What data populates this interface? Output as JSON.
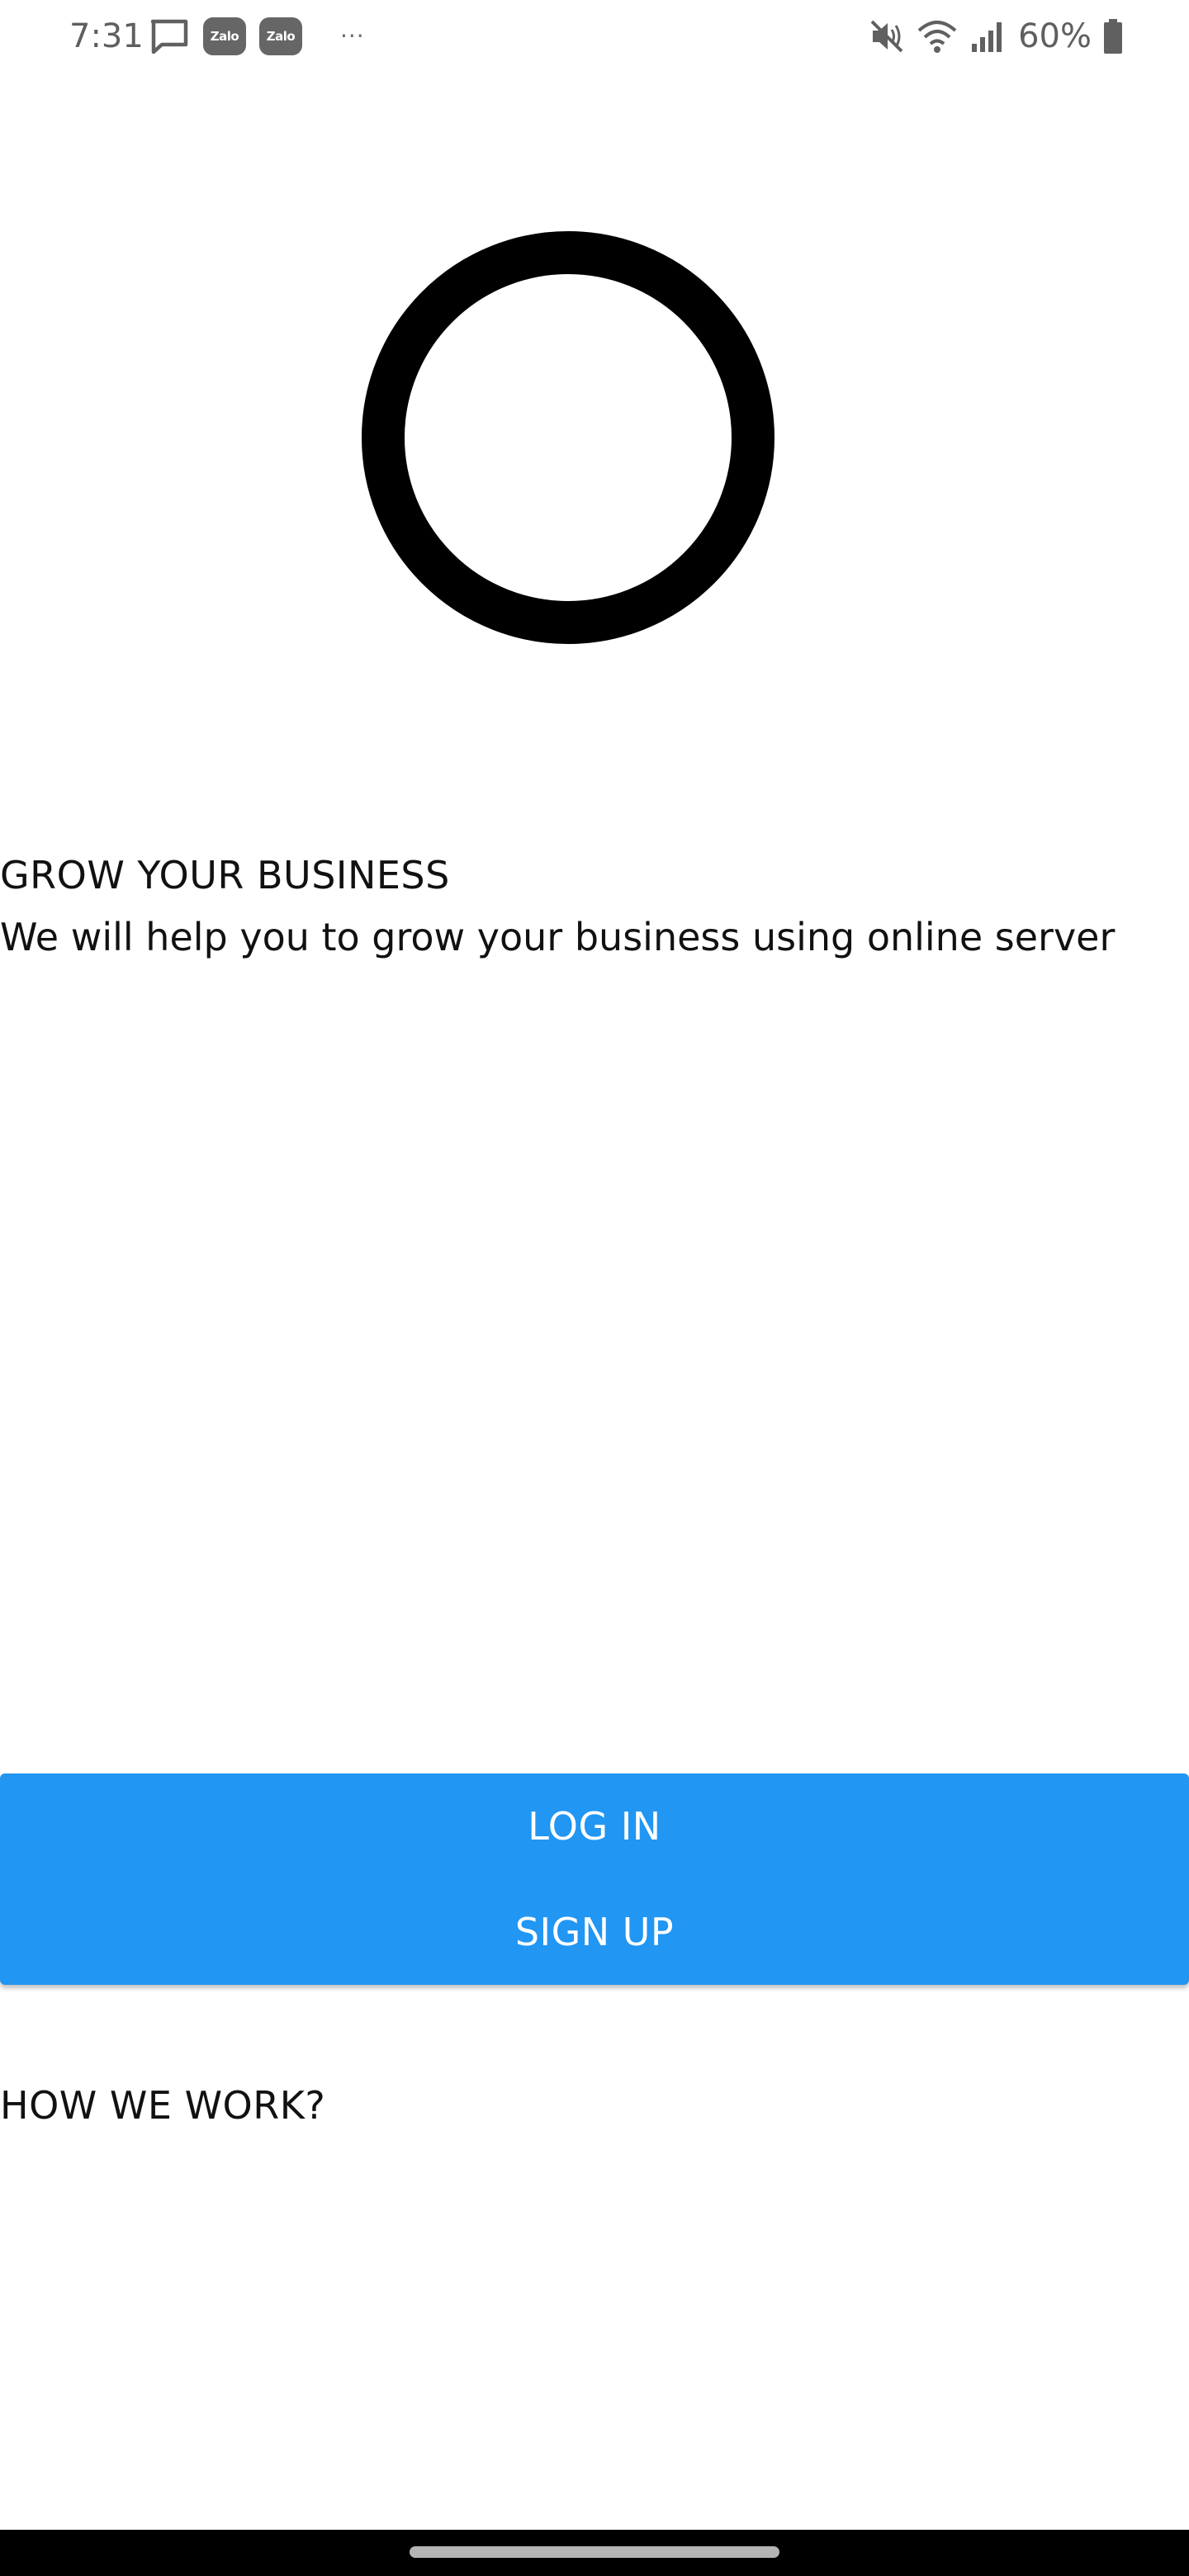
{
  "status_bar": {
    "time": "7:31",
    "notification_icons": [
      "message-icon",
      "zalo-icon",
      "zalo-icon"
    ],
    "zalo_label": "Zalo",
    "more_indicator": "···",
    "system_icons": [
      "mute-icon",
      "wifi-icon",
      "signal-icon",
      "battery-icon"
    ],
    "battery_percent": "60%"
  },
  "hero": {
    "logo_icon": "ring-logo-icon"
  },
  "intro": {
    "headline": "GROW YOUR BUSINESS",
    "subtitle": "We will help you to grow your business using online server"
  },
  "actions": {
    "login_label": "LOG IN",
    "signup_label": "SIGN UP",
    "button_color": "#2196f3"
  },
  "how_we_work": {
    "title": "HOW WE WORK?"
  }
}
